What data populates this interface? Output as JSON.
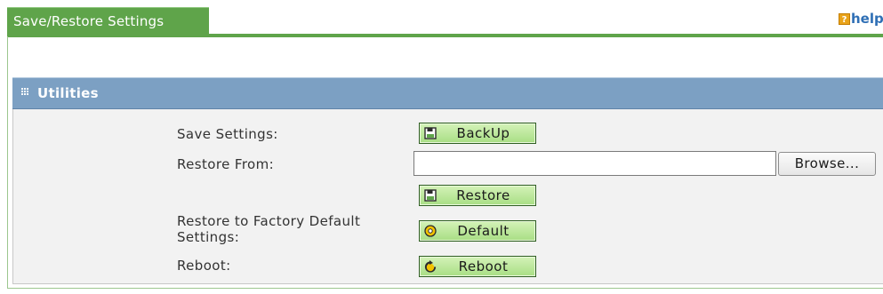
{
  "tab": {
    "title": "Save/Restore Settings"
  },
  "help": {
    "icon": "help-icon",
    "label": "help"
  },
  "section": {
    "title": "Utilities",
    "icon": "grip-icon"
  },
  "rows": {
    "save": {
      "label": "Save Settings:",
      "button_label": "BackUp",
      "button_icon": "save-icon"
    },
    "restore_from": {
      "label": "Restore From:",
      "input_value": "",
      "browse_label": "Browse..."
    },
    "restore": {
      "button_label": "Restore",
      "button_icon": "save-icon"
    },
    "factory": {
      "label_line1": "Restore to Factory Default",
      "label_line2": "Settings:",
      "button_label": "Default",
      "button_icon": "default-icon"
    },
    "reboot": {
      "label": "Reboot:",
      "button_label": "Reboot",
      "button_icon": "reboot-icon"
    }
  },
  "colors": {
    "tab_green": "#5fa44a",
    "header_blue": "#7ca0c3",
    "button_green": "#a8de84",
    "help_blue": "#2f6fb5"
  }
}
